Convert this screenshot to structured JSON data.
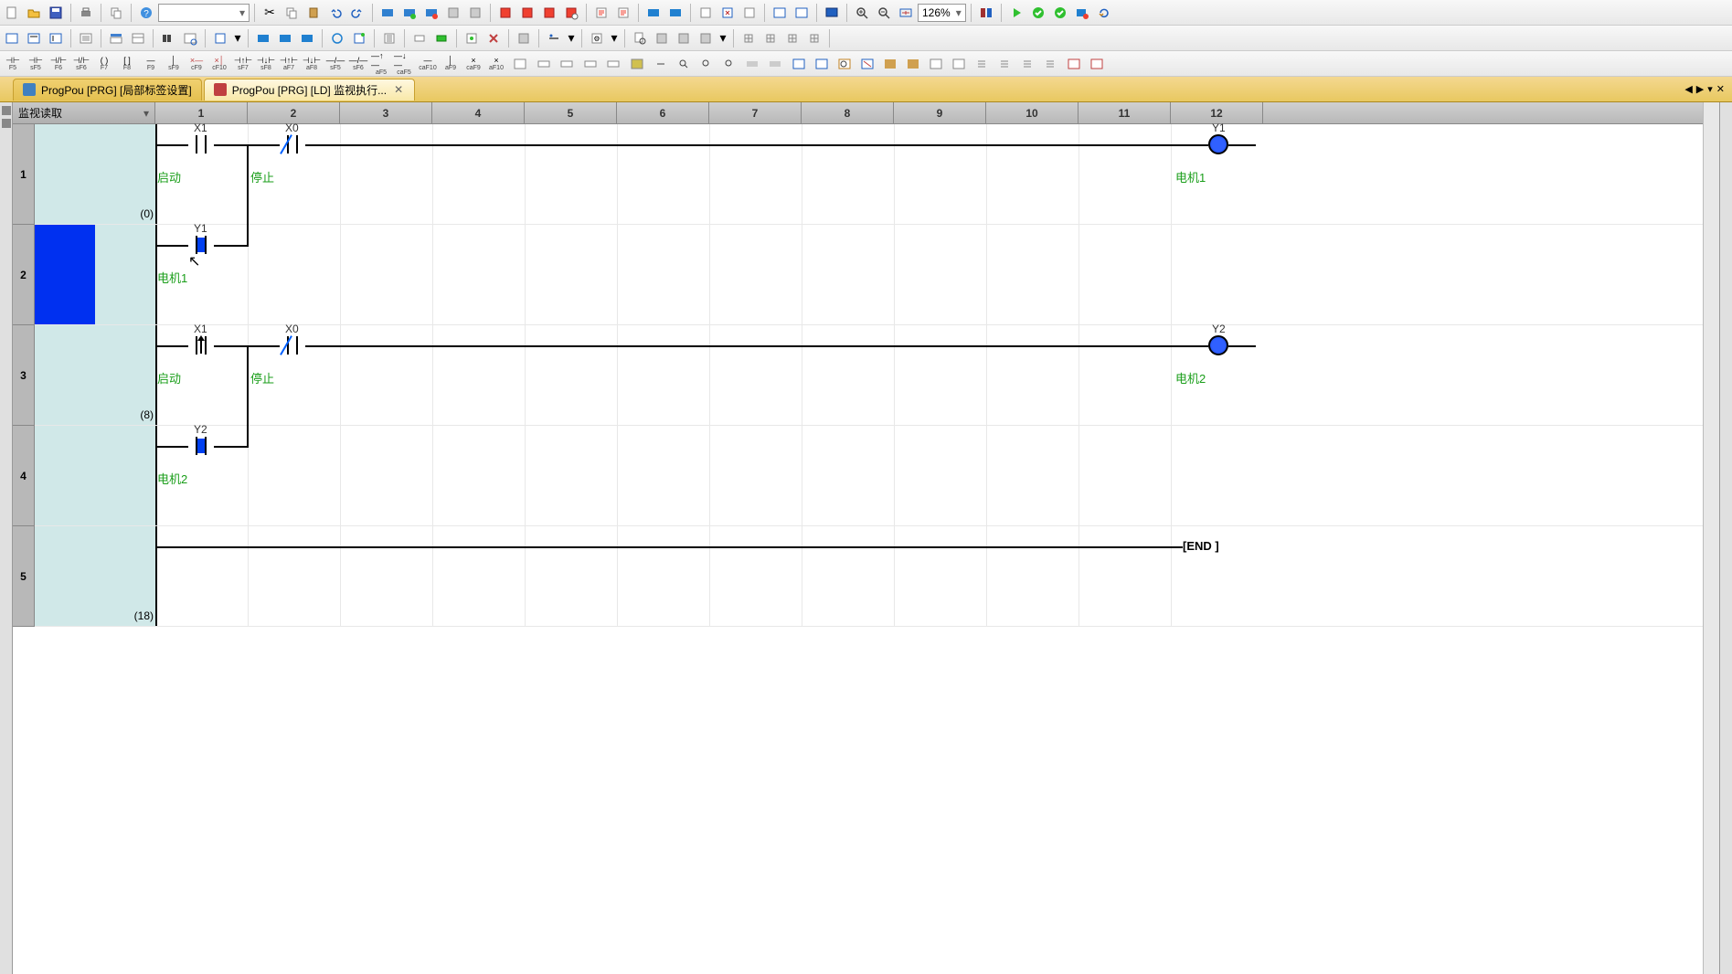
{
  "toolbar": {
    "zoom": "126%"
  },
  "mode_label": "监视读取",
  "tabs": [
    {
      "label": "ProgPou [PRG] [局部标签设置]"
    },
    {
      "label": "ProgPou [PRG] [LD] 监视执行..."
    }
  ],
  "columns": [
    "1",
    "2",
    "3",
    "4",
    "5",
    "6",
    "7",
    "8",
    "9",
    "10",
    "11",
    "12"
  ],
  "ld_keys": [
    "F5",
    "sF5",
    "F6",
    "sF6",
    "F7",
    "F8",
    "F9",
    "sF9",
    "cF9",
    "cF10",
    "sF7",
    "sF8",
    "aF7",
    "aF8",
    "sF5",
    "sF6",
    "aF5",
    "caF5",
    "caF10",
    "aF9",
    "caF9",
    "aF10"
  ],
  "rows": [
    {
      "num": "1",
      "step": "(0)"
    },
    {
      "num": "2",
      "step": ""
    },
    {
      "num": "3",
      "step": "(8)"
    },
    {
      "num": "4",
      "step": ""
    },
    {
      "num": "5",
      "step": "(18)"
    }
  ],
  "ladder": {
    "r1": {
      "x1": {
        "dev": "X1",
        "comment": "启动"
      },
      "x0": {
        "dev": "X0",
        "comment": "停止"
      },
      "y1": {
        "dev": "Y1",
        "comment": "电机1"
      }
    },
    "r2": {
      "y1": {
        "dev": "Y1",
        "comment": "电机1"
      }
    },
    "r3": {
      "x1": {
        "dev": "X1",
        "comment": "启动"
      },
      "x0": {
        "dev": "X0",
        "comment": "停止"
      },
      "y2": {
        "dev": "Y2",
        "comment": "电机2"
      }
    },
    "r4": {
      "y2": {
        "dev": "Y2",
        "comment": "电机2"
      }
    },
    "r5": {
      "end": "[END      ]"
    }
  }
}
